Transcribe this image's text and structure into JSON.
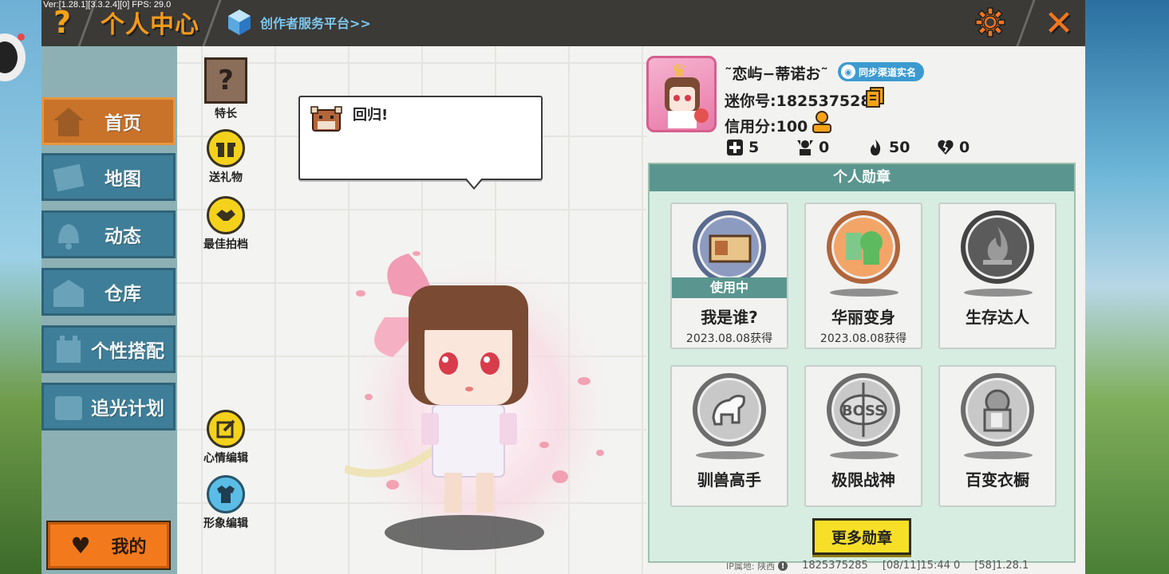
{
  "version_text": "Ver:[1.28.1][3.3.2.4][0] FPS: 29.0",
  "header": {
    "title": "个人中心",
    "creator_link": "创作者服务平台>>",
    "help_icon": "question-mark-icon",
    "settings_icon": "gear-icon",
    "close_icon": "close-icon"
  },
  "sidebar": {
    "items": [
      {
        "label": "首页",
        "icon": "home-icon",
        "active": true
      },
      {
        "label": "地图",
        "icon": "map-icon",
        "active": false
      },
      {
        "label": "动态",
        "icon": "bell-icon",
        "active": false
      },
      {
        "label": "仓库",
        "icon": "warehouse-icon",
        "active": false
      },
      {
        "label": "个性搭配",
        "icon": "outfit-icon",
        "active": false
      },
      {
        "label": "追光计划",
        "icon": "m-badge-icon",
        "active": false
      }
    ],
    "mine_button": "我的"
  },
  "tools": {
    "specialty": "特长",
    "send_gift": "送礼物",
    "best_partner": "最佳拍档",
    "mood_edit": "心情编辑",
    "avatar_edit": "形象编辑"
  },
  "speech": {
    "message": "回归!"
  },
  "profile": {
    "nickname": "˜恋屿−蒂诺お˜",
    "sync_badge": "同步渠道实名",
    "mini_id": "迷你号:1825375285",
    "credit": "信用分:100",
    "stats": [
      {
        "icon": "plus-square-icon",
        "value": "5"
      },
      {
        "icon": "trophy-person-icon",
        "value": "0"
      },
      {
        "icon": "flame-icon",
        "value": "50"
      },
      {
        "icon": "broken-heart-icon",
        "value": "0"
      }
    ]
  },
  "medals": {
    "title": "个人勋章",
    "in_use_label": "使用中",
    "items": [
      {
        "name": "我是谁?",
        "date": "2023.08.08获得",
        "in_use": true,
        "icon": "id-card-medal-icon"
      },
      {
        "name": "华丽变身",
        "date": "2023.08.08获得",
        "in_use": false,
        "icon": "dino-costume-medal-icon"
      },
      {
        "name": "生存达人",
        "date": "",
        "in_use": false,
        "icon": "campfire-medal-icon"
      },
      {
        "name": "驯兽高手",
        "date": "",
        "in_use": false,
        "icon": "horse-medal-icon"
      },
      {
        "name": "极限战神",
        "date": "",
        "in_use": false,
        "icon": "boss-medal-icon"
      },
      {
        "name": "百变衣橱",
        "date": "",
        "in_use": false,
        "icon": "wardrobe-medal-icon"
      }
    ],
    "more_button": "更多勋章"
  },
  "footer": {
    "ip_location": "IP属地: 陕西",
    "uid": "1825375285",
    "time": "[08/11]15:44 0",
    "build": "[58]1.28.1"
  },
  "colors": {
    "accent_orange": "#f39a1a",
    "nav_blue": "#3f7e98",
    "nav_active": "#c9722a",
    "medal_green": "#5a968f",
    "button_yellow": "#f8df27"
  }
}
